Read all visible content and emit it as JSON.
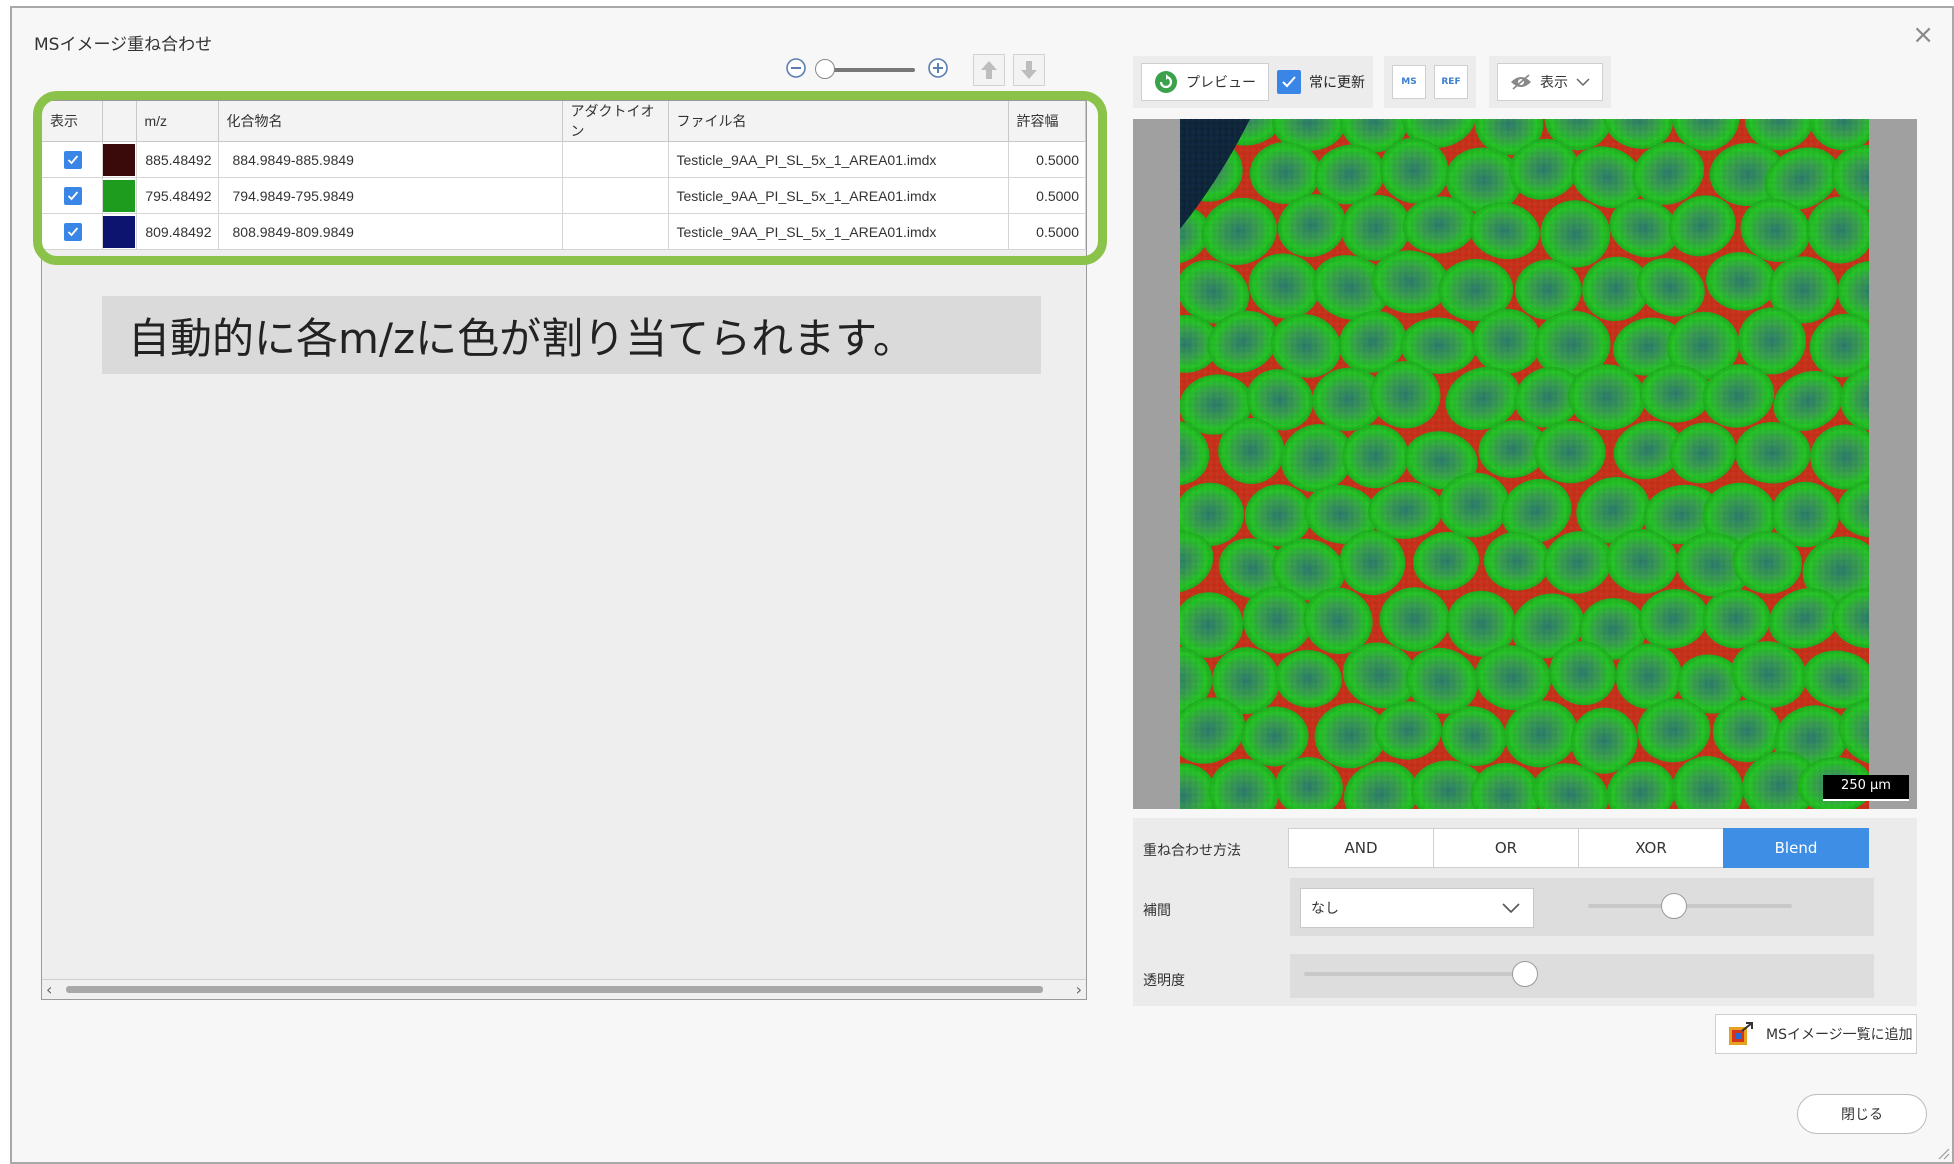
{
  "window": {
    "title": "MSイメージ重ね合わせ",
    "close_glyph": "×"
  },
  "left_toolbar": {
    "zoom_out_icon": "zoom-out-icon",
    "zoom_in_icon": "zoom-in-icon",
    "zoom_level": 0.05,
    "move_up_icon": "arrow-up-icon",
    "move_down_icon": "arrow-down-icon"
  },
  "table": {
    "headers": {
      "show": "表示",
      "color": "",
      "mz": "m/z",
      "compound": "化合物名",
      "adduct": "アダクトイオン",
      "filename": "ファイル名",
      "tolerance": "許容幅"
    },
    "rows": [
      {
        "checked": true,
        "color": "#3a0a0a",
        "mz": "885.48492",
        "compound": "884.9849-885.9849",
        "adduct": "",
        "filename": "Testicle_9AA_PI_SL_5x_1_AREA01.imdx",
        "tolerance": "0.5000"
      },
      {
        "checked": true,
        "color": "#1e9c1e",
        "mz": "795.48492",
        "compound": "794.9849-795.9849",
        "adduct": "",
        "filename": "Testicle_9AA_PI_SL_5x_1_AREA01.imdx",
        "tolerance": "0.5000"
      },
      {
        "checked": true,
        "color": "#0c1470",
        "mz": "809.48492",
        "compound": "808.9849-809.9849",
        "adduct": "",
        "filename": "Testicle_9AA_PI_SL_5x_1_AREA01.imdx",
        "tolerance": "0.5000"
      }
    ]
  },
  "annotation": {
    "text": "自動的に各m/zに色が割り当てられます。",
    "highlight_color": "#8bc34a"
  },
  "right_toolbar": {
    "preview_label": "プレビュー",
    "always_update_label": "常に更新",
    "always_update_checked": true,
    "ms_button_label": "MS",
    "ref_button_label": "REF",
    "view_label": "表示"
  },
  "image": {
    "scale_label": "250 μm"
  },
  "settings": {
    "overlay_label": "重ね合わせ方法",
    "methods": [
      "AND",
      "OR",
      "XOR",
      "Blend"
    ],
    "selected_method": "Blend",
    "interp_label": "補間",
    "interp_value": "なし",
    "interp_level": 0.42,
    "transparency_label": "透明度",
    "transparency_level": 0.38
  },
  "buttons": {
    "add_to_list": "MSイメージ一覧に追加",
    "close": "閉じる"
  },
  "colors": {
    "accent": "#3a86e6",
    "active_segment": "#3f8ee6",
    "highlight": "#8bc34a"
  }
}
